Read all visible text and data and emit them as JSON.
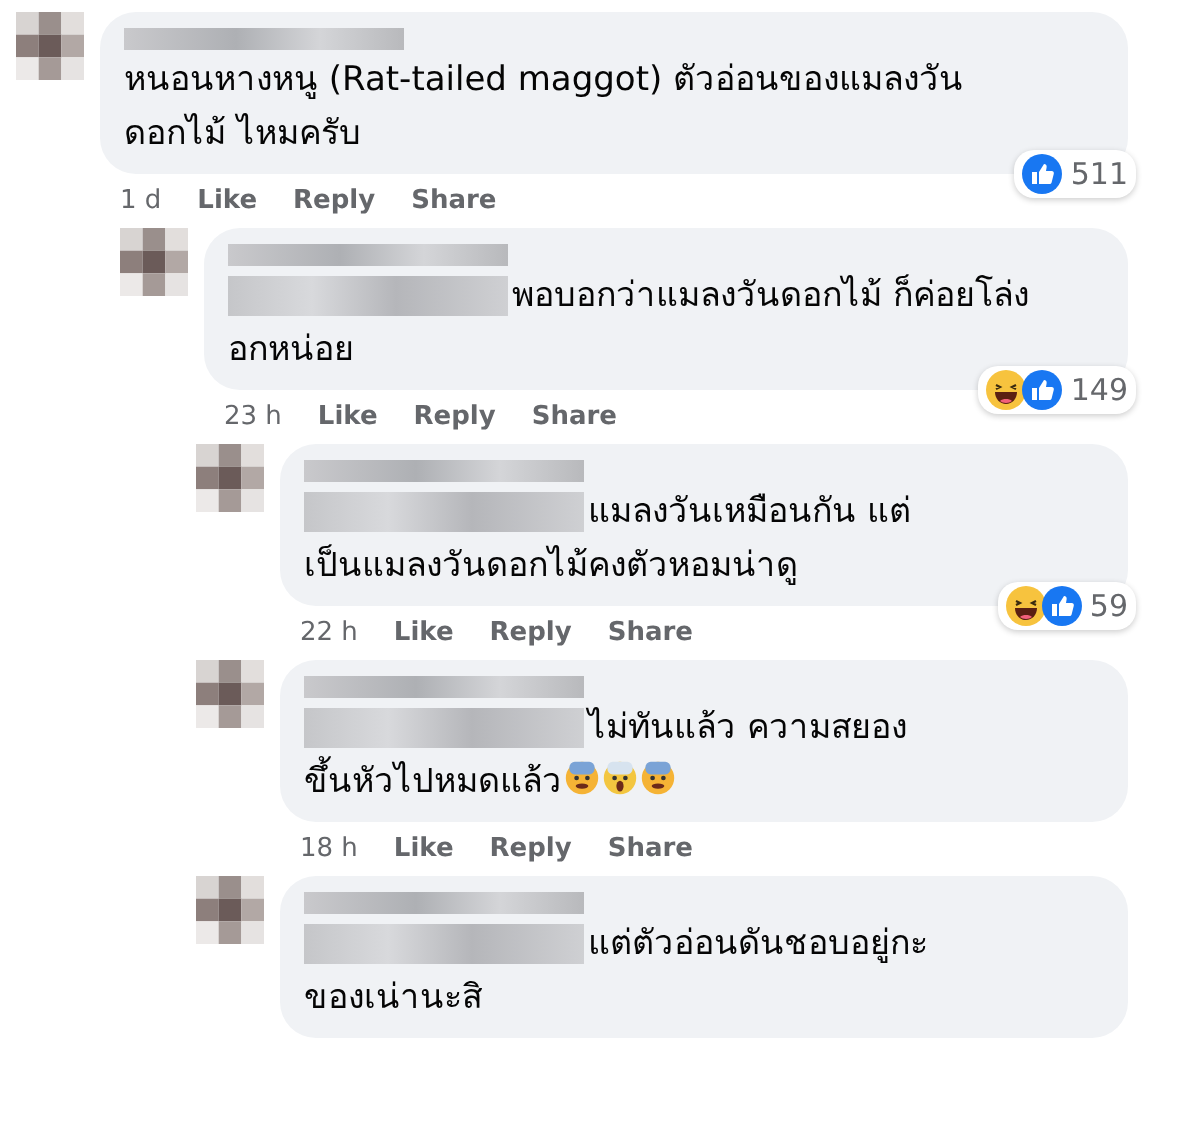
{
  "comments": [
    {
      "redacted_prefix": false,
      "lines": [
        "หนอนหางหนู (Rat-tailed maggot) ตัวอ่อนของแมลงวัน",
        "ดอกไม้ ไหมครับ"
      ],
      "reactions": [
        {
          "kind": "like"
        }
      ],
      "reaction_count": "511",
      "time": "1 d",
      "actions": [
        "Like",
        "Reply",
        "Share"
      ],
      "children": [
        {
          "redacted_prefix": true,
          "lines": [
            "พอบอกว่าแมลงวันดอกไม้ ก็ค่อยโล่ง",
            "อกหน่อย"
          ],
          "reactions": [
            {
              "kind": "haha"
            },
            {
              "kind": "like"
            }
          ],
          "reaction_count": "149",
          "time": "23 h",
          "actions": [
            "Like",
            "Reply",
            "Share"
          ],
          "children": [
            {
              "redacted_prefix": true,
              "lines": [
                "แมลงวันเหมือนกัน แต่",
                "เป็นแมลงวันดอกไม้คงตัวหอมน่าดู"
              ],
              "reactions": [
                {
                  "kind": "haha"
                },
                {
                  "kind": "like"
                }
              ],
              "reaction_count": "59",
              "time": "22 h",
              "actions": [
                "Like",
                "Reply",
                "Share"
              ]
            },
            {
              "redacted_prefix": true,
              "lines": [
                "ไม่ทันแล้ว ความสยอง",
                "ขึ้นหัวไปหมดแล้ว"
              ],
              "emoji": [
                {
                  "kind": "fearful"
                },
                {
                  "kind": "screaming"
                },
                {
                  "kind": "fearful"
                }
              ],
              "time": "18 h",
              "actions": [
                "Like",
                "Reply",
                "Share"
              ]
            },
            {
              "redacted_prefix": true,
              "lines": [
                "แต่ตัวอ่อนดันชอบอยู่กะ",
                "ของเน่านะสิ"
              ]
            }
          ]
        }
      ]
    }
  ]
}
